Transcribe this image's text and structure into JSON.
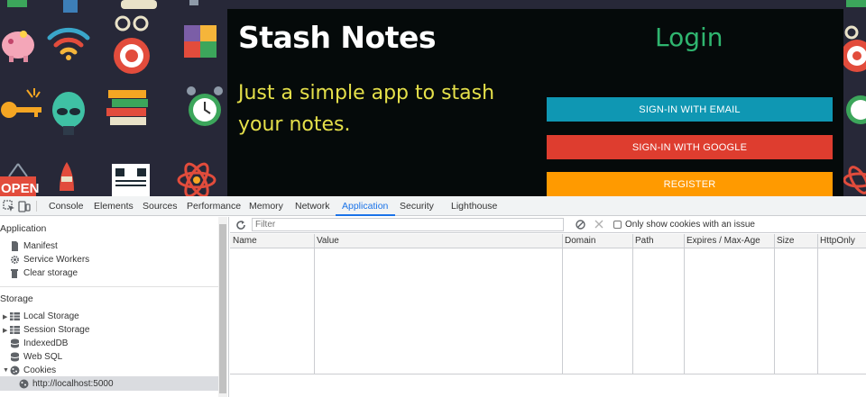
{
  "app": {
    "title": "Stash Notes",
    "tagline": "Just a simple app to stash your notes.",
    "login_heading": "Login",
    "buttons": {
      "email": "SIGN-IN WITH EMAIL",
      "google": "SIGN-IN WITH GOOGLE",
      "register": "REGISTER"
    },
    "background_sign": "OPEN",
    "colors": {
      "email": "#0f97b3",
      "google": "#de3d2f",
      "register": "#ff9a00",
      "login": "#2fb56f",
      "tagline": "#e5e04a"
    }
  },
  "devtools": {
    "tabs": [
      "Console",
      "Elements",
      "Sources",
      "Performance",
      "Memory",
      "Network",
      "Application",
      "Security",
      "Lighthouse"
    ],
    "active_tab": "Application",
    "sidebar": {
      "application_heading": "Application",
      "application_items": [
        {
          "label": "Manifest",
          "icon": "document-icon"
        },
        {
          "label": "Service Workers",
          "icon": "gear-icon"
        },
        {
          "label": "Clear storage",
          "icon": "trash-icon"
        }
      ],
      "storage_heading": "Storage",
      "storage_items": [
        {
          "label": "Local Storage",
          "icon": "grid-icon"
        },
        {
          "label": "Session Storage",
          "icon": "grid-icon"
        },
        {
          "label": "IndexedDB",
          "icon": "database-icon"
        },
        {
          "label": "Web SQL",
          "icon": "database-icon"
        },
        {
          "label": "Cookies",
          "icon": "cookie-icon"
        }
      ],
      "cookie_origin": "http://localhost:5000"
    },
    "toolbar": {
      "filter_placeholder": "Filter",
      "only_issues_label": "Only show cookies with an issue"
    },
    "columns": [
      "Name",
      "Value",
      "Domain",
      "Path",
      "Expires / Max-Age",
      "Size",
      "HttpOnly"
    ]
  }
}
